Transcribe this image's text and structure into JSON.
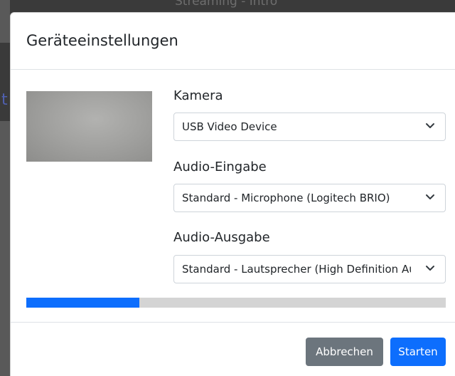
{
  "background": {
    "page_title": "Streaming - Intro"
  },
  "modal": {
    "title": "Geräteeinstellungen",
    "camera": {
      "label": "Kamera",
      "selected": "USB Video Device"
    },
    "audio_input": {
      "label": "Audio-Eingabe",
      "selected": "Standard - Microphone (Logitech BRIO)"
    },
    "audio_output": {
      "label": "Audio-Ausgabe",
      "selected": "Standard - Lautsprecher (High Definition Audio)"
    },
    "audio_level": 0.27,
    "buttons": {
      "cancel": "Abbrechen",
      "start": "Starten"
    }
  },
  "colors": {
    "primary": "#0d6efd",
    "secondary": "#6c757d",
    "progress_track": "#d4d4d4"
  },
  "icons": {
    "select_arrow": "chevron-down-icon"
  }
}
